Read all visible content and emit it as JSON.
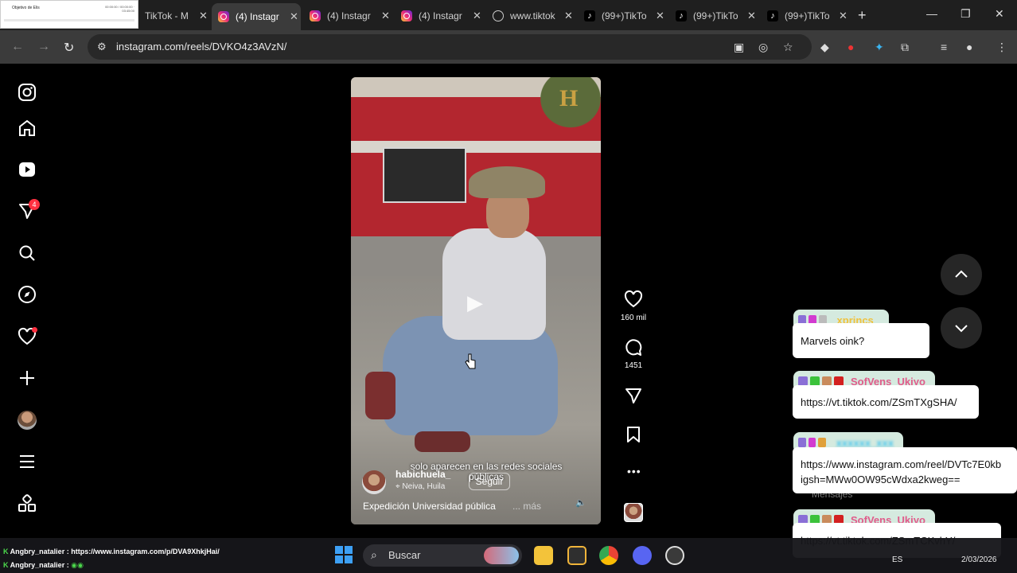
{
  "browser": {
    "thumb_title": "Objetivo de Elis",
    "thumb_meta": "00:00:00 / 00:00:00 · 03:45:00",
    "tabs": [
      {
        "title": "TikTok - M",
        "icon": "none"
      },
      {
        "title": "(4) Instagr",
        "icon": "instagram"
      },
      {
        "title": "(4) Instagr",
        "icon": "instagram"
      },
      {
        "title": "(4) Instagr",
        "icon": "instagram"
      },
      {
        "title": "www.tiktok",
        "icon": "globe"
      },
      {
        "title": "(99+)TikTo",
        "icon": "tiktok"
      },
      {
        "title": "(99+)TikTo",
        "icon": "tiktok"
      },
      {
        "title": "(99+)TikTo",
        "icon": "tiktok"
      }
    ],
    "url": "instagram.com/reels/DVKO4z3AVzN/",
    "accent": "#3b3b3b"
  },
  "sidebar": {
    "notification_count": "4",
    "items": [
      "instagram-logo-icon",
      "home-icon",
      "reels-icon",
      "messages-icon",
      "search-icon",
      "explore-icon",
      "notifications-icon",
      "create-icon",
      "profile-avatar",
      "more-icon",
      "also-from-meta-icon"
    ]
  },
  "reel": {
    "author": "habichuela_",
    "location": "Neiva, Huila",
    "follow_label": "Seguir",
    "subtitle": "solo aparecen en las redes sociales públicas",
    "caption": "Expedición Universidad pública",
    "more_label": "... más",
    "watermark": "H",
    "likes": "160 mil",
    "comments": "1451"
  },
  "chat": [
    {
      "user": "xprincs_",
      "user_color": "#f0c23c",
      "message": "Marvels oink?"
    },
    {
      "user": "SofVens_Ukiyo",
      "user_color": "#e05b8a",
      "message": "https://vt.tiktok.com/ZSmTXgSHA/"
    },
    {
      "user": "xxxxxx_xxx",
      "user_color": "#46c6f0",
      "message_line1": "https://www.instagram.com/reel/DVTc7E0kb",
      "message_line2": "igsh=MWw0OW95cWdxa2kweg=="
    },
    {
      "user": "SofVens_Ukiyo",
      "user_color": "#e05b8a",
      "message": "https://vt.tiktok.com/ZSmTCKvhY/"
    }
  ],
  "overlay": [
    {
      "user": "Angbry_natalier",
      "message": "https://www.instagram.com/p/DVA9XhkjHai/"
    },
    {
      "user": "Angbry_natalier",
      "message": ""
    }
  ],
  "taskbar": {
    "search_placeholder": "Buscar",
    "lang": "ES",
    "date": "2/03/2026"
  }
}
